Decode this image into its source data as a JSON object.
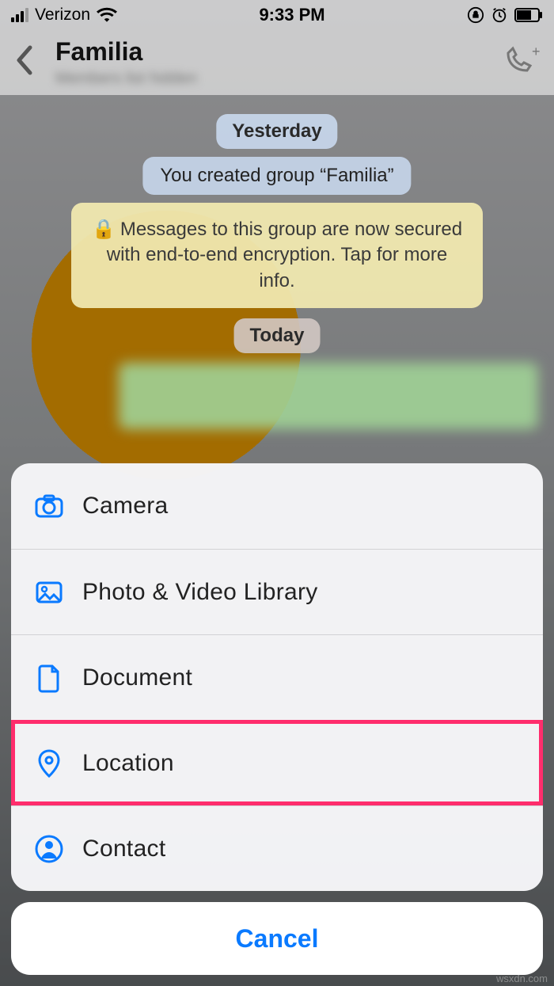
{
  "status": {
    "carrier": "Verizon",
    "time": "9:33 PM"
  },
  "header": {
    "chat_title": "Familia",
    "chat_subtitle": "Members list hidden"
  },
  "chat": {
    "yesterday_label": "Yesterday",
    "system_msg": "You created group “Familia”",
    "encryption_msg": "Messages to this group are now secured with end-to-end encryption. Tap for more info.",
    "today_label": "Today"
  },
  "sheet": {
    "items": [
      {
        "label": "Camera",
        "icon": "camera-icon"
      },
      {
        "label": "Photo & Video Library",
        "icon": "photo-icon"
      },
      {
        "label": "Document",
        "icon": "document-icon"
      },
      {
        "label": "Location",
        "icon": "location-icon",
        "highlighted": true
      },
      {
        "label": "Contact",
        "icon": "contact-icon"
      }
    ],
    "cancel_label": "Cancel"
  },
  "watermark": "wsxdn.com"
}
